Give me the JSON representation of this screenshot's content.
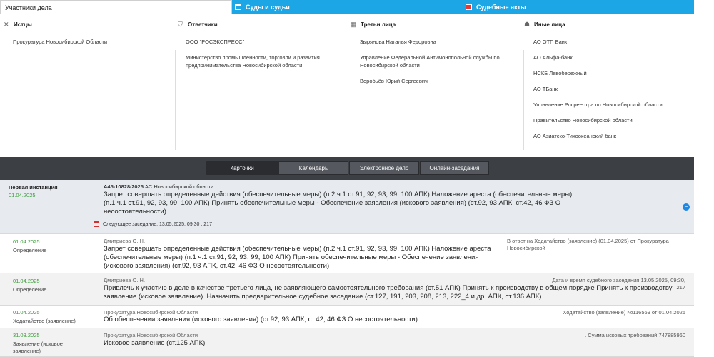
{
  "tabs": [
    {
      "label": "Участники дела",
      "active": true
    },
    {
      "label": "Суды и судьи",
      "active": false
    },
    {
      "label": "Судебные акты",
      "active": false
    }
  ],
  "participants": {
    "plaintiffs": {
      "title": "Истцы",
      "items": [
        "Прокуратура Новосибирской Области"
      ]
    },
    "defendants": {
      "title": "Ответчики",
      "items": [
        "ООО \"РОСЭКСПРЕСС\"",
        "Министерство промышленности, торговли и развития предпринимательства Новосибирской области"
      ]
    },
    "third_parties": {
      "title": "Третьи лица",
      "items": [
        "Зырянова Наталья Федоровна",
        "Управление Федеральной Антимонопольной службы по Новосибирской области",
        "Воробьёв Юрий Сергеевич"
      ]
    },
    "others": {
      "title": "Иные лица",
      "items": [
        "АО ОТП Банк",
        "АО Альфа-банк",
        "НСКБ Левобережный",
        "АО ТБанк",
        "Управление Росреестра по Новосибирской области",
        "Правительство Новосибирской области",
        "АО Азиатско-Тихоокеанский банк"
      ]
    }
  },
  "toolbar": {
    "buttons": [
      "Карточки",
      "Календарь",
      "Электронное дело",
      "Онлайн-заседания"
    ]
  },
  "instance": {
    "label": "Первая инстанция",
    "date": "01.04.2025",
    "case_number": "А45-10828/2025",
    "court": "АС Новосибирской области",
    "description": "Запрет совершать определенные действия (обеспечительные меры) (п.2 ч.1 ст.91, 92, 93, 99, 100 АПК) Наложение ареста (обеспечительные меры) (п.1 ч.1 ст.91, 92, 93, 99, 100 АПК) Принять обеспечительные меры - Обеспечение заявления (искового заявления) (ст.92, 93 АПК, ст.42, 46 ФЗ О несостоятельности)",
    "next_hearing": "Следующее заседание: 13.05.2025, 09:30 , 217"
  },
  "events": [
    {
      "date": "01.04.2025",
      "kind": "Определение",
      "author": "Дмитриева О. Н.",
      "text": "Запрет совершать определенные действия (обеспечительные меры) (п.2 ч.1 ст.91, 92, 93, 99, 100 АПК) Наложение ареста (обеспечительные меры) (п.1 ч.1 ст.91, 92, 93, 99, 100 АПК) Принять обеспечительные меры - Обеспечение заявления (искового заявления) (ст.92, 93 АПК, ст.42, 46 ФЗ О несостоятельности)",
      "note": "В ответ на Ходатайство (заявление) (01.04.2025) от Прокуратура Новосибирской"
    },
    {
      "date": "01.04.2025",
      "kind": "Определение",
      "author": "Дмитриева О. Н.",
      "text": "Привлечь к участию в деле в качестве третьего лица, не заявляющего самостоятельного требования (ст.51 АПК) Принять к производству в общем порядке Принять к производству заявление (исковое заявление). Назначить предварительное судебное заседание (ст.127, 191, 203, 208, 213, 222_4 и др. АПК, ст.136 АПК)",
      "note": "Дата и время судебного заседания 13.05.2025, 09:30, 217"
    },
    {
      "date": "01.04.2025",
      "kind": "Ходатайство (заявление)",
      "author": "Прокуратура Новосибирской Области",
      "text": "Об обеспечении заявления (искового заявления) (ст.92, 93 АПК, ст.42, 46 ФЗ О несостоятельности)",
      "note": "Ходатайство (заявление) №116569 от 01.04.2025"
    },
    {
      "date": "31.03.2025",
      "kind": "Заявление (исковое заявление)",
      "author": "Прокуратура Новосибирской Области",
      "text": "Исковое заявление (ст.125 АПК)",
      "note": ". Сумма исковых требований 747885960"
    }
  ]
}
